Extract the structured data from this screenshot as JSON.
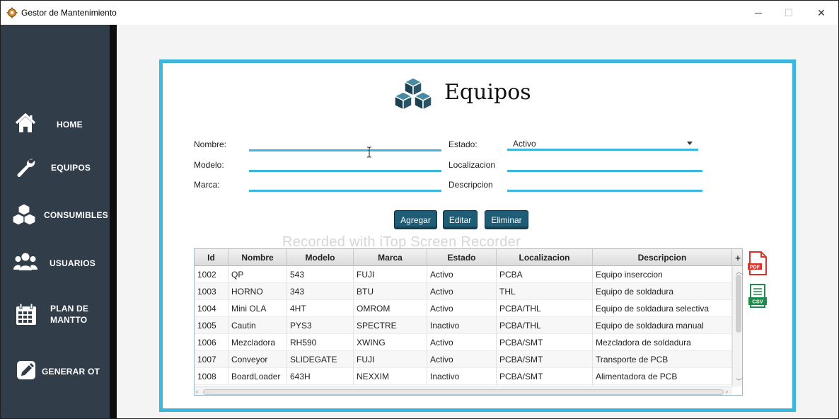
{
  "window": {
    "title": "Gestor de Mantenimiento",
    "minimize": "─",
    "maximize": "☐",
    "close": "✕"
  },
  "sidebar": {
    "items": [
      {
        "label": "HOME",
        "icon": "home-icon"
      },
      {
        "label": "EQUIPOS",
        "icon": "wrench-icon"
      },
      {
        "label": "CONSUMIBLES",
        "icon": "boxes-icon"
      },
      {
        "label": "USUARIOS",
        "icon": "users-icon"
      },
      {
        "label_line1": "PLAN DE",
        "label_line2": "MANTTO",
        "icon": "calendar-icon"
      },
      {
        "label": "GENERAR OT",
        "icon": "edit-icon"
      }
    ]
  },
  "header": {
    "title": "Equipos",
    "icon": "cubes-icon"
  },
  "form": {
    "nombre_label": "Nombre:",
    "nombre_value": "",
    "modelo_label": "Modelo:",
    "modelo_value": "",
    "marca_label": "Marca:",
    "marca_value": "",
    "estado_label": "Estado:",
    "estado_value": "Activo",
    "localizacion_label": "Localizacion",
    "localizacion_value": "",
    "descripcion_label": "Descripcion",
    "descripcion_value": ""
  },
  "buttons": {
    "agregar": "Agregar",
    "editar": "Editar",
    "eliminar": "Eliminar"
  },
  "watermark": "Recorded with iTop Screen Recorder",
  "table": {
    "columns": [
      "Id",
      "Nombre",
      "Modelo",
      "Marca",
      "Estado",
      "Localizacion",
      "Descripcion"
    ],
    "add_column": "+",
    "rows": [
      [
        "1002",
        "QP",
        "543",
        "FUJI",
        "Activo",
        "PCBA",
        "Equipo inserccion"
      ],
      [
        "1003",
        "HORNO",
        "343",
        "BTU",
        "Activo",
        "THL",
        "Equipo de soldadura"
      ],
      [
        "1004",
        "Mini OLA",
        "4HT",
        "OMROM",
        "Activo",
        "PCBA/THL",
        "Equipo de soldadura selectiva"
      ],
      [
        "1005",
        "Cautin",
        "PYS3",
        "SPECTRE",
        "Inactivo",
        "PCBA/THL",
        "Equipo de soldadura manual"
      ],
      [
        "1006",
        "Mezcladora",
        "RH590",
        "XWING",
        "Activo",
        "PCBA/SMT",
        "Mezcladora de soldadura"
      ],
      [
        "1007",
        "Conveyor",
        "SLIDEGATE",
        "FUJI",
        "Activo",
        "PCBA/SMT",
        "Transporte de PCB"
      ],
      [
        "1008",
        "BoardLoader",
        "643H",
        "NEXXIM",
        "Inactivo",
        "PCBA/SMT",
        "Alimentadora de PCB"
      ]
    ]
  },
  "export": {
    "pdf_label": "PDF",
    "csv_label": "CSV"
  },
  "colors": {
    "sidebar_bg": "#323d4a",
    "accent": "#3cb6dc",
    "button_bg": "#1f5c75",
    "header_icon": "#2a5566"
  }
}
